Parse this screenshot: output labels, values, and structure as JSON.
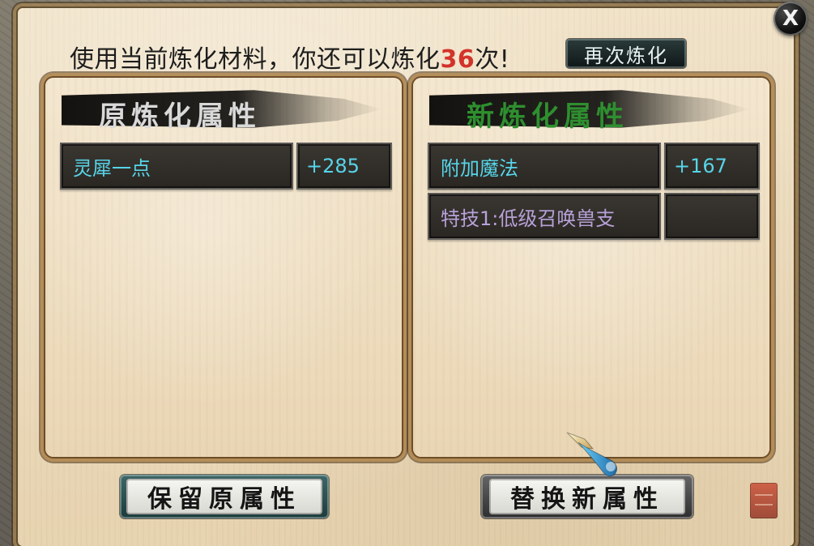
{
  "header": {
    "prefix": "使用当前炼化材料，你还可以炼化",
    "count": "36",
    "suffix": "次!",
    "refine_again_button": "再次炼化"
  },
  "left_panel": {
    "title": "原炼化属性",
    "rows": [
      {
        "name": "灵犀一点",
        "value": "+285"
      }
    ]
  },
  "right_panel": {
    "title": "新炼化属性",
    "rows": [
      {
        "name": "附加魔法",
        "value": "+167"
      },
      {
        "name": "特技1:低级召唤兽支",
        "value": ""
      }
    ]
  },
  "buttons": {
    "keep_original": "保留原属性",
    "replace_new": "替换新属性"
  },
  "window": {
    "close_label": "X"
  },
  "colors": {
    "attribute_text": "#56d4e8",
    "skill_text": "#b7a1d8",
    "count_text": "#d3332a",
    "new_title": "#2e8f2f"
  },
  "icons": {
    "close": "close-icon",
    "cursor": "pointer-cursor-icon",
    "seal": "seal-stamp-icon"
  }
}
